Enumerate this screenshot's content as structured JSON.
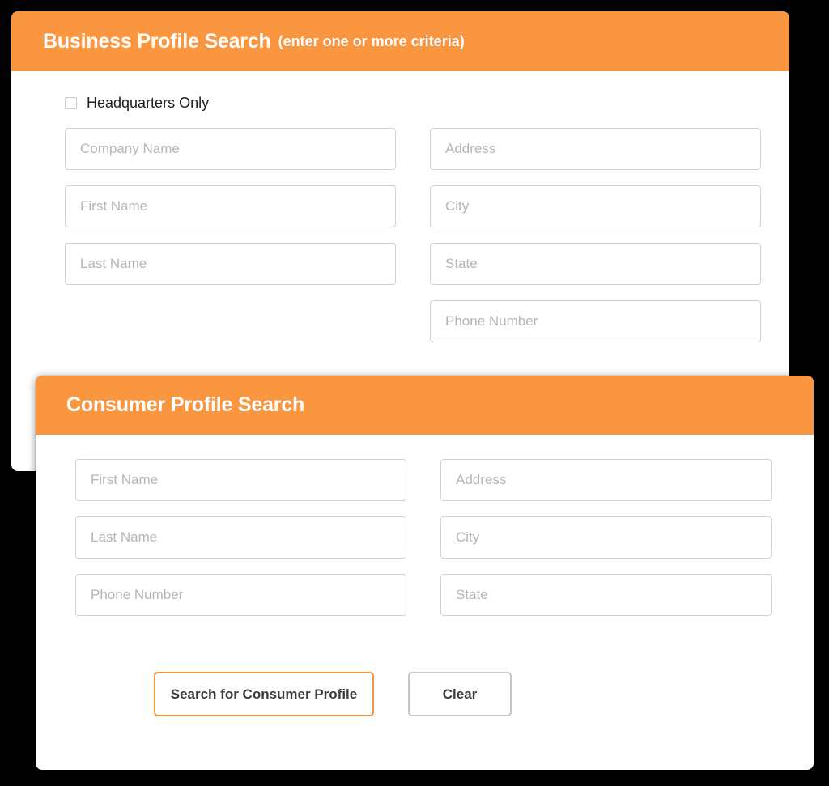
{
  "business_card": {
    "title": "Business Profile Search",
    "subtitle": "(enter one or more criteria)",
    "checkbox": {
      "label": "Headquarters Only",
      "checked": false
    },
    "fields_left": [
      {
        "placeholder": "Company Name",
        "value": ""
      },
      {
        "placeholder": "First Name",
        "value": ""
      },
      {
        "placeholder": "Last Name",
        "value": ""
      }
    ],
    "fields_right": [
      {
        "placeholder": "Address",
        "value": ""
      },
      {
        "placeholder": "City",
        "value": ""
      },
      {
        "placeholder": "State",
        "value": ""
      },
      {
        "placeholder": "Phone Number",
        "value": ""
      }
    ]
  },
  "consumer_card": {
    "title": "Consumer Profile Search",
    "fields_left": [
      {
        "placeholder": "First Name",
        "value": ""
      },
      {
        "placeholder": "Last Name",
        "value": ""
      },
      {
        "placeholder": "Phone Number",
        "value": ""
      }
    ],
    "fields_right": [
      {
        "placeholder": "Address",
        "value": ""
      },
      {
        "placeholder": "City",
        "value": ""
      },
      {
        "placeholder": "State",
        "value": ""
      }
    ],
    "buttons": {
      "search_label": "Search for Consumer Profile",
      "clear_label": "Clear"
    }
  },
  "colors": {
    "header_orange": "#FA9540",
    "primary_button_border": "#F0933E",
    "secondary_button_border": "#C6C6C6",
    "field_border": "#D2D2D2",
    "placeholder_text": "#B5B5B5",
    "page_background": "#000000"
  }
}
